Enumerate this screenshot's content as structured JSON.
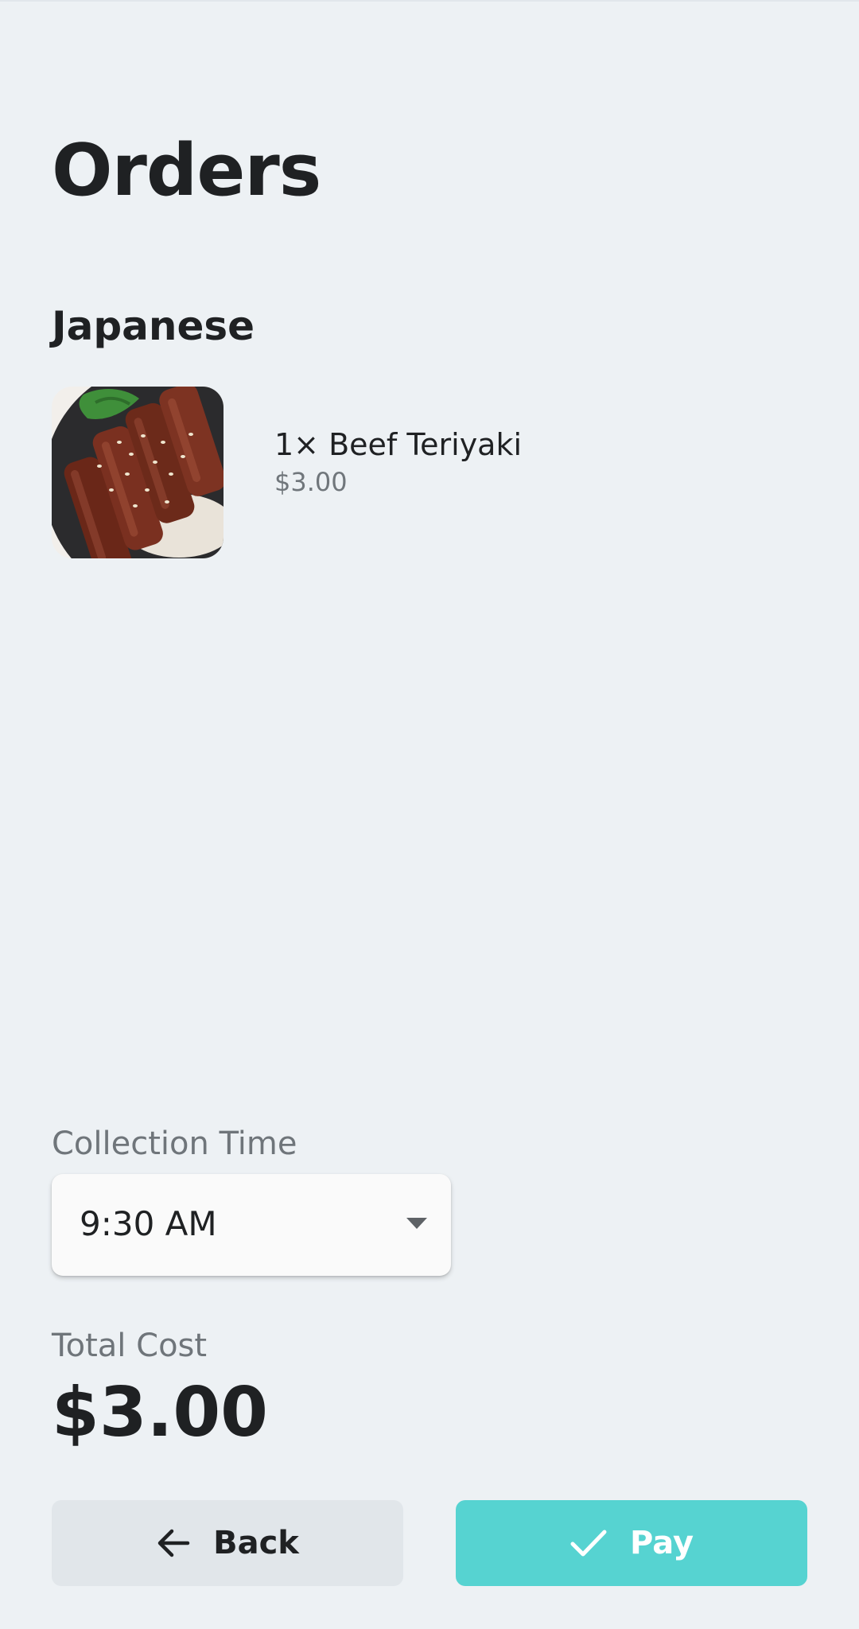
{
  "page": {
    "title": "Orders"
  },
  "order_group": {
    "cuisine": "Japanese",
    "items": [
      {
        "quantity_name": "1× Beef Teriyaki",
        "price": "$3.00",
        "image_icon": "beef-teriyaki-photo"
      }
    ]
  },
  "collection": {
    "label": "Collection Time",
    "selected_time": "9:30 AM",
    "dropdown_icon": "caret-down-icon"
  },
  "total": {
    "label": "Total Cost",
    "value": "$3.00"
  },
  "actions": {
    "back_label": "Back",
    "back_icon": "arrow-left-icon",
    "pay_label": "Pay",
    "pay_icon": "check-icon"
  },
  "colors": {
    "background": "#edf1f4",
    "accent": "#56d3d1",
    "secondary_button": "#e1e6ea",
    "text_primary": "#1f2123",
    "text_secondary": "#70767b"
  }
}
